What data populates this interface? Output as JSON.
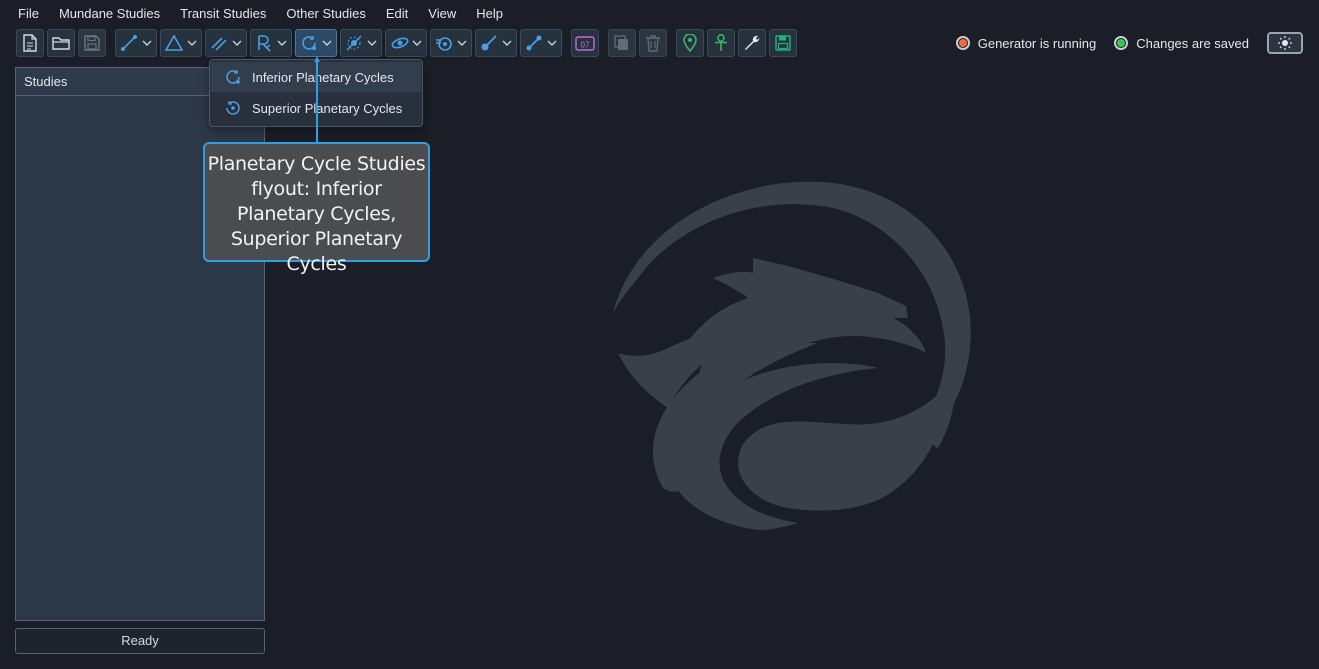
{
  "menubar": {
    "items": [
      "File",
      "Mundane Studies",
      "Transit Studies",
      "Other Studies",
      "Edit",
      "View",
      "Help"
    ]
  },
  "toolbar": {
    "buttons": [
      {
        "icon": "new-document-icon"
      },
      {
        "icon": "open-folder-icon"
      },
      {
        "icon": "save-disk-icon",
        "disabled": true
      },
      {
        "icon": "aspects-icon",
        "dropdown": true
      },
      {
        "icon": "triangle-icon",
        "dropdown": true
      },
      {
        "icon": "parallels-icon",
        "dropdown": true
      },
      {
        "icon": "retrograde-icon",
        "dropdown": true
      },
      {
        "icon": "planetary-cycles-icon",
        "dropdown": true,
        "active": true
      },
      {
        "icon": "eclipse-icon",
        "dropdown": true
      },
      {
        "icon": "lunation-icon",
        "dropdown": true
      },
      {
        "icon": "ingress-icon",
        "dropdown": true
      },
      {
        "icon": "stations-icon",
        "dropdown": true
      },
      {
        "icon": "declination-icon",
        "dropdown": true
      },
      {
        "icon": "calendar-icon",
        "badge": "07"
      },
      {
        "icon": "copy-icon",
        "disabled": true
      },
      {
        "icon": "trash-icon",
        "disabled": true
      },
      {
        "icon": "location-pin-icon"
      },
      {
        "icon": "ankh-icon"
      },
      {
        "icon": "wrench-icon"
      },
      {
        "icon": "save-green-icon"
      }
    ]
  },
  "status": {
    "generator_label": "Generator is running",
    "generator_color": "#f06a3c",
    "changes_label": "Changes are saved",
    "changes_color": "#35c94f"
  },
  "studies_panel": {
    "title": "Studies"
  },
  "status_bar": {
    "text": "Ready"
  },
  "flyout": {
    "items": [
      {
        "label": "Inferior Planetary Cycles",
        "icon": "inferior-cycle-icon",
        "hover": true
      },
      {
        "label": "Superior Planetary Cycles",
        "icon": "superior-cycle-icon"
      }
    ]
  },
  "callout": {
    "text": "Planetary Cycle Studies flyout: Inferior Planetary Cycles, Superior Planetary Cycles"
  },
  "colors": {
    "accent": "#2f9fe4",
    "background": "#1b1e26",
    "logo": "#3a3f49"
  }
}
